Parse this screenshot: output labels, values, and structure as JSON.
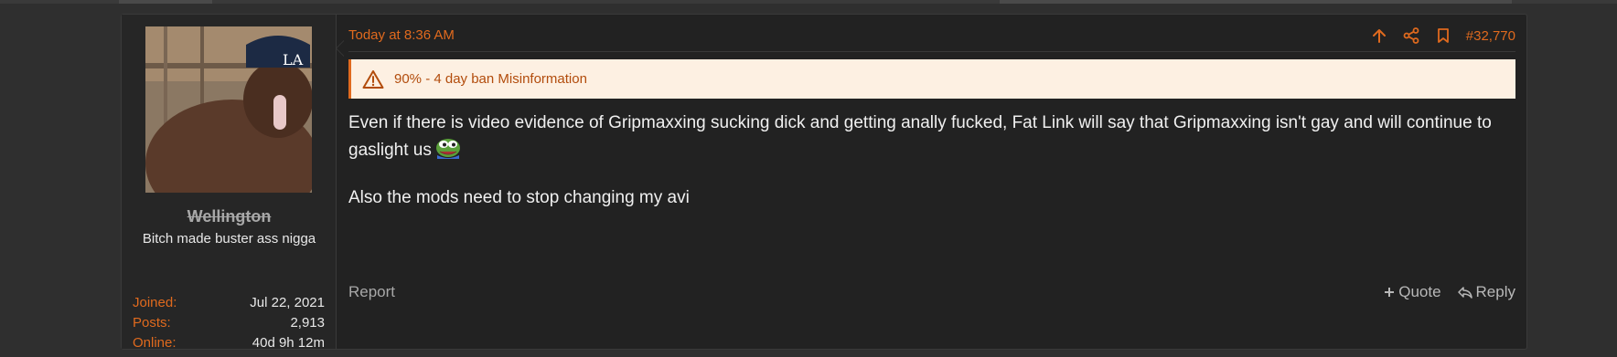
{
  "post": {
    "user": {
      "username": "Wellington",
      "title": "Bitch made buster ass nigga",
      "stats": [
        {
          "label": "Joined:",
          "value": "Jul 22, 2021"
        },
        {
          "label": "Posts:",
          "value": "2,913"
        },
        {
          "label": "Online:",
          "value": "40d 9h 12m"
        }
      ]
    },
    "date": "Today at 8:36 AM",
    "post_number": "#32,770",
    "warning": "90% - 4 day ban Misinformation",
    "body": {
      "paragraph1": "Even if there is video evidence of Gripmaxxing sucking dick and getting anally fucked, Fat Link will say that Gripmaxxing isn't gay and will continue to gaslight us",
      "paragraph2": "Also the mods need to stop changing my avi"
    },
    "footer": {
      "report": "Report",
      "quote": "Quote",
      "reply": "Reply"
    }
  },
  "colors": {
    "accent": "#e06a1e",
    "background": "#2f2f2f",
    "panel": "#222222",
    "warning_bg": "#fdf0e2"
  },
  "icons": [
    "upvote-arrow-icon",
    "share-icon",
    "bookmark-icon",
    "warning-triangle-icon",
    "pepe-emoji-icon",
    "plus-icon",
    "reply-icon"
  ]
}
